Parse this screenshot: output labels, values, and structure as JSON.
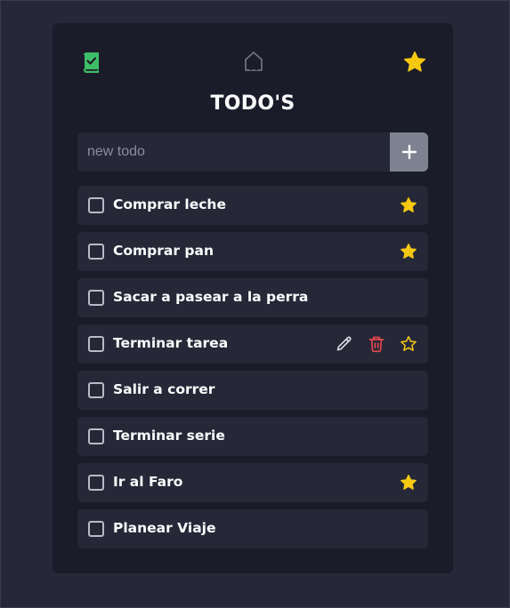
{
  "header": {
    "title": "TODO'S",
    "left_icon": "book-check-icon",
    "center_icon": "home-icon",
    "right_icon": "star-filled-icon"
  },
  "new_todo": {
    "placeholder": "new todo",
    "value": "",
    "add_icon": "plus-icon"
  },
  "colors": {
    "background": "#262839",
    "card": "#1b1c29",
    "item": "#262838",
    "star": "#f6c90e",
    "delete": "#e5484d",
    "accent_green": "#3fbe6a",
    "add_button": "#7d8290"
  },
  "todos": [
    {
      "label": "Comprar leche",
      "completed": false,
      "favorite": true,
      "hovered": false
    },
    {
      "label": "Comprar pan",
      "completed": false,
      "favorite": true,
      "hovered": false
    },
    {
      "label": "Sacar a pasear a la perra",
      "completed": false,
      "favorite": false,
      "hovered": false
    },
    {
      "label": "Terminar tarea",
      "completed": false,
      "favorite": false,
      "hovered": true
    },
    {
      "label": "Salir a correr",
      "completed": false,
      "favorite": false,
      "hovered": false
    },
    {
      "label": "Terminar serie",
      "completed": false,
      "favorite": false,
      "hovered": false
    },
    {
      "label": "Ir al Faro",
      "completed": false,
      "favorite": true,
      "hovered": false
    },
    {
      "label": "Planear Viaje",
      "completed": false,
      "favorite": false,
      "hovered": false
    }
  ]
}
